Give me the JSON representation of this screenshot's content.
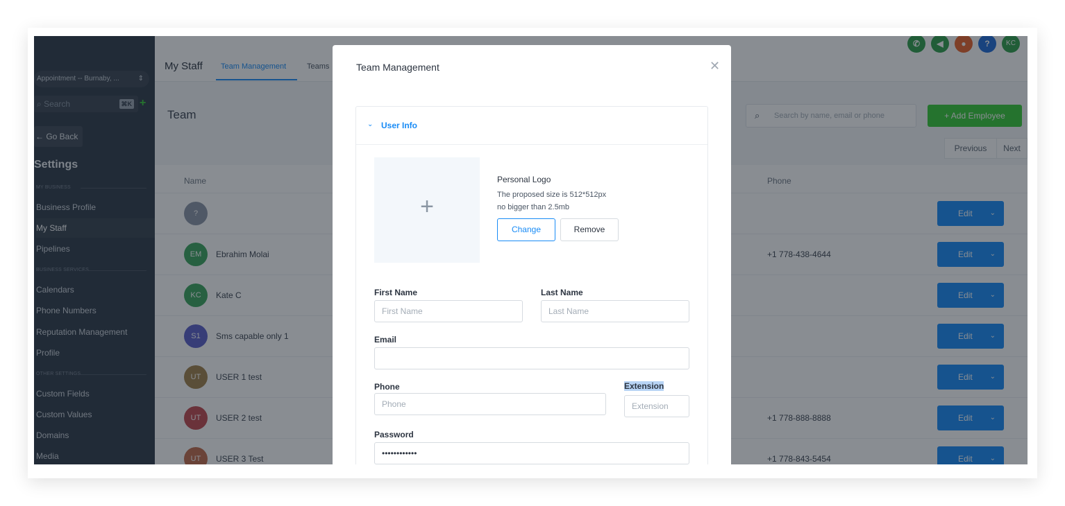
{
  "sidebar": {
    "location": "Appointment -- Burnaby, ...",
    "search_placeholder": "Search",
    "search_shortcut": "⌘K",
    "go_back": "← Go Back",
    "settings_title": "Settings",
    "sections": [
      {
        "label": "MY BUSINESS"
      },
      {
        "label": "BUSINESS SERVICES"
      },
      {
        "label": "OTHER SETTINGS"
      }
    ],
    "items": [
      {
        "label": "Business Profile"
      },
      {
        "label": "My Staff"
      },
      {
        "label": "Pipelines"
      },
      {
        "label": "Calendars"
      },
      {
        "label": "Phone Numbers"
      },
      {
        "label": "Reputation Management"
      },
      {
        "label": "Profile"
      },
      {
        "label": "Custom Fields"
      },
      {
        "label": "Custom Values"
      },
      {
        "label": "Domains"
      },
      {
        "label": "Media"
      }
    ]
  },
  "header": {
    "page_title": "My Staff",
    "tabs": [
      {
        "label": "Team Management"
      },
      {
        "label": "Teams"
      }
    ],
    "icons": [
      {
        "name": "phone-icon",
        "color": "#2e9e4a"
      },
      {
        "name": "megaphone-icon",
        "color": "#2e9e4a"
      },
      {
        "name": "bell-icon",
        "color": "#e8622a"
      },
      {
        "name": "help-icon",
        "color": "#1e6ad6",
        "text": "?"
      },
      {
        "name": "avatar",
        "color": "#2e9e4a",
        "text": "KC"
      }
    ]
  },
  "team": {
    "title": "Team",
    "search_placeholder": "Search by name, email or phone",
    "add_employee": "+ Add Employee",
    "previous": "Previous",
    "next": "Next",
    "columns": {
      "name": "Name",
      "phone": "Phone"
    },
    "edit_label": "Edit",
    "rows": [
      {
        "initials": "?",
        "name": "",
        "phone": "",
        "color": "#8a94a6"
      },
      {
        "initials": "EM",
        "name": "Ebrahim Molai",
        "phone": "+1 778-438-4644",
        "color": "#3aa55d"
      },
      {
        "initials": "KC",
        "name": "Kate C",
        "phone": "",
        "color": "#3aa55d"
      },
      {
        "initials": "S1",
        "name": "Sms capable only 1",
        "phone": "",
        "color": "#5a5fc8"
      },
      {
        "initials": "UT",
        "name": "USER 1 test",
        "phone": "",
        "color": "#a0804a"
      },
      {
        "initials": "UT",
        "name": "USER 2 test",
        "phone": "+1 778-888-8888",
        "color": "#c0484f"
      },
      {
        "initials": "UT",
        "name": "USER 3 Test",
        "phone": "+1 778-843-5454",
        "color": "#c06a4a"
      }
    ]
  },
  "modal": {
    "title": "Team Management",
    "section_label": "User Info",
    "logo": {
      "title": "Personal Logo",
      "line1": "The proposed size is 512*512px",
      "line2": "no bigger than 2.5mb",
      "change": "Change",
      "remove": "Remove"
    },
    "fields": {
      "first_name": {
        "label": "First Name",
        "placeholder": "First Name",
        "value": ""
      },
      "last_name": {
        "label": "Last Name",
        "placeholder": "Last Name",
        "value": ""
      },
      "email": {
        "label": "Email",
        "placeholder": "",
        "value": ""
      },
      "phone": {
        "label": "Phone",
        "placeholder": "Phone",
        "value": ""
      },
      "extension": {
        "label": "Extension",
        "placeholder": "Extension",
        "value": ""
      },
      "password": {
        "label": "Password",
        "value": "••••••••••••"
      }
    }
  }
}
